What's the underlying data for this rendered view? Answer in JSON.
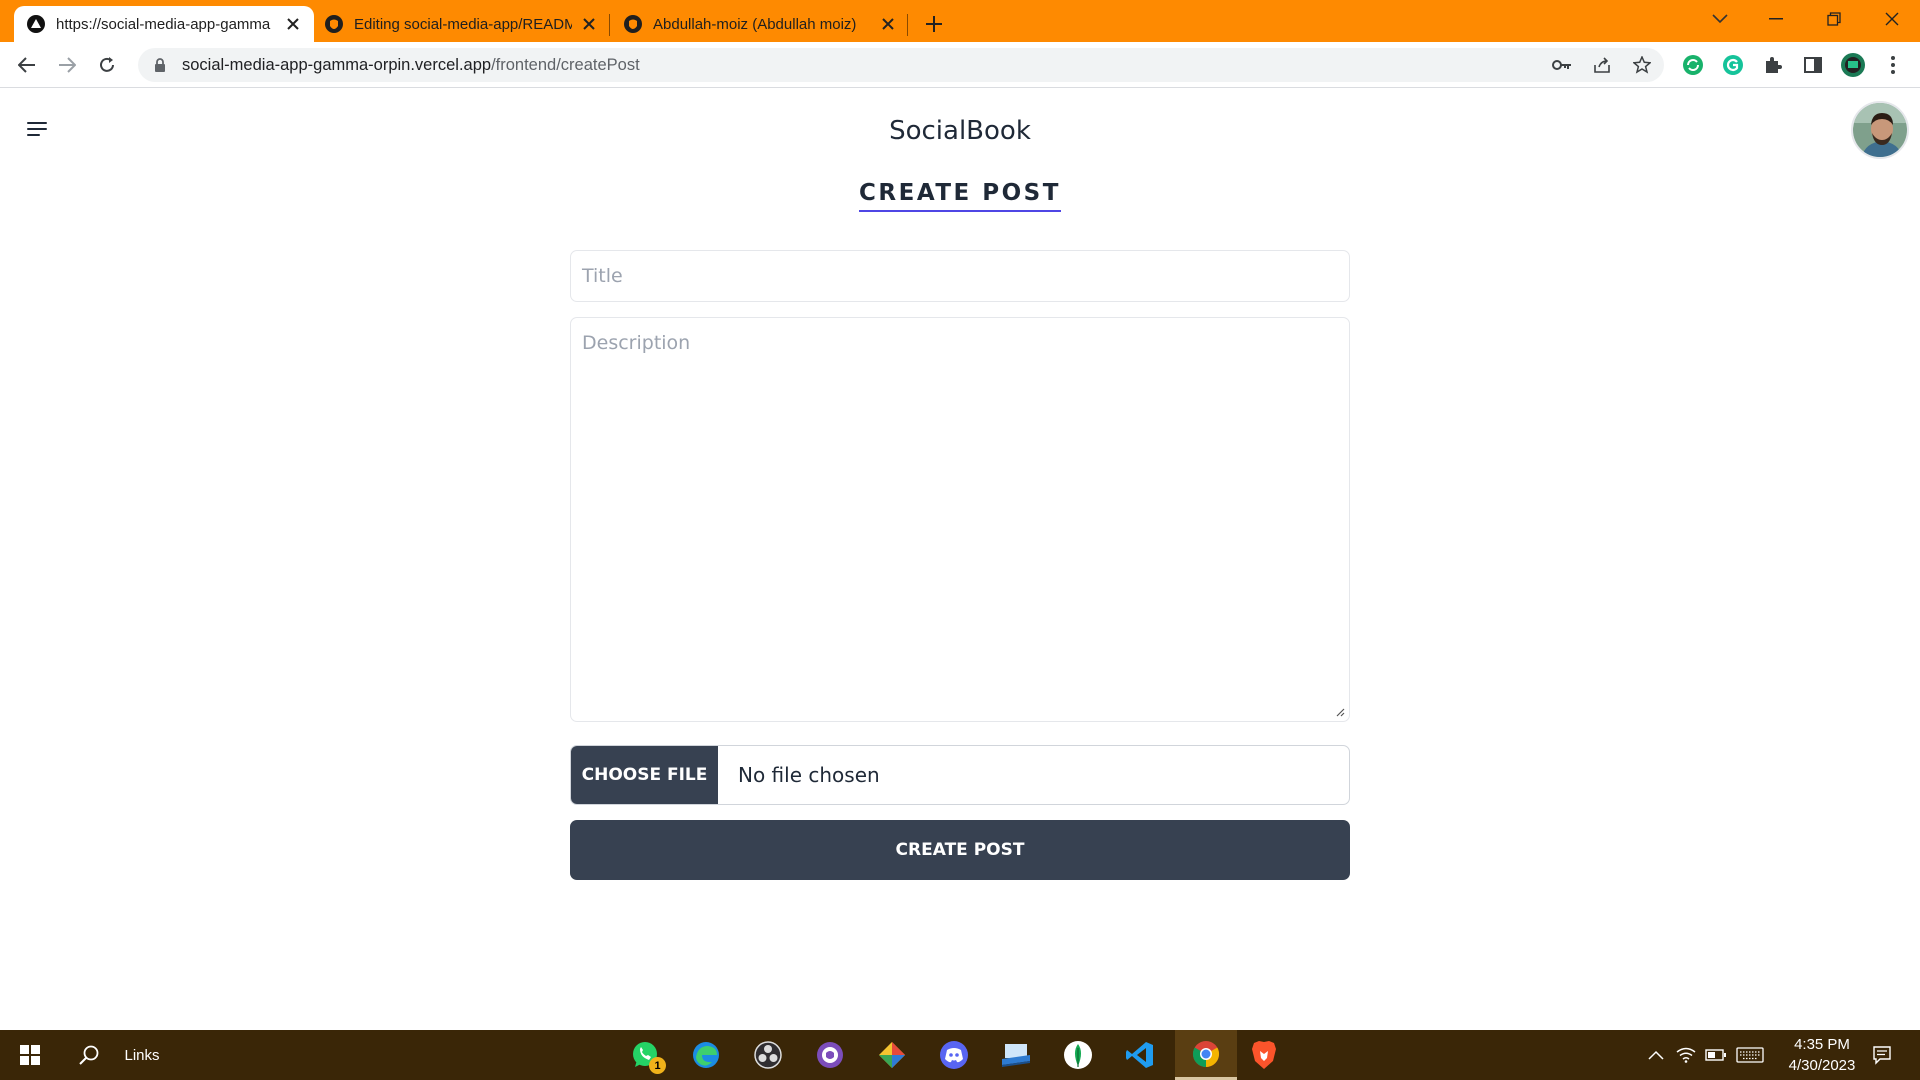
{
  "browser": {
    "tabs": [
      {
        "title": "https://social-media-app-gamma",
        "icon": "vercel-icon",
        "active": true
      },
      {
        "title": "Editing social-media-app/READM",
        "icon": "github-icon",
        "active": false
      },
      {
        "title": "Abdullah-moiz (Abdullah moiz)",
        "icon": "github-icon",
        "active": false
      }
    ],
    "url": {
      "host": "social-media-app-gamma-orpin.vercel.app",
      "path": "/frontend/createPost"
    },
    "accent": "#fe8a01"
  },
  "page": {
    "brand": "SocialBook",
    "heading": "CREATE POST",
    "title_placeholder": "Title",
    "description_placeholder": "Description",
    "choose_file_label": "CHOOSE FILE",
    "file_status": "No file chosen",
    "submit_label": "CREATE POST",
    "colors": {
      "button": "#374151",
      "heading_underline": "#4f46e5",
      "text": "#1f2937"
    }
  },
  "taskbar": {
    "links_label": "Links",
    "whatsapp_badge": "1",
    "time": "4:35 PM",
    "date": "4/30/2023",
    "apps": [
      "whatsapp-icon",
      "edge-icon",
      "obs-icon",
      "github-desktop-icon",
      "git-kraken-icon",
      "discord-icon",
      "file-explorer-icon",
      "mongodb-icon",
      "vscode-icon",
      "chrome-icon",
      "brave-icon"
    ]
  }
}
